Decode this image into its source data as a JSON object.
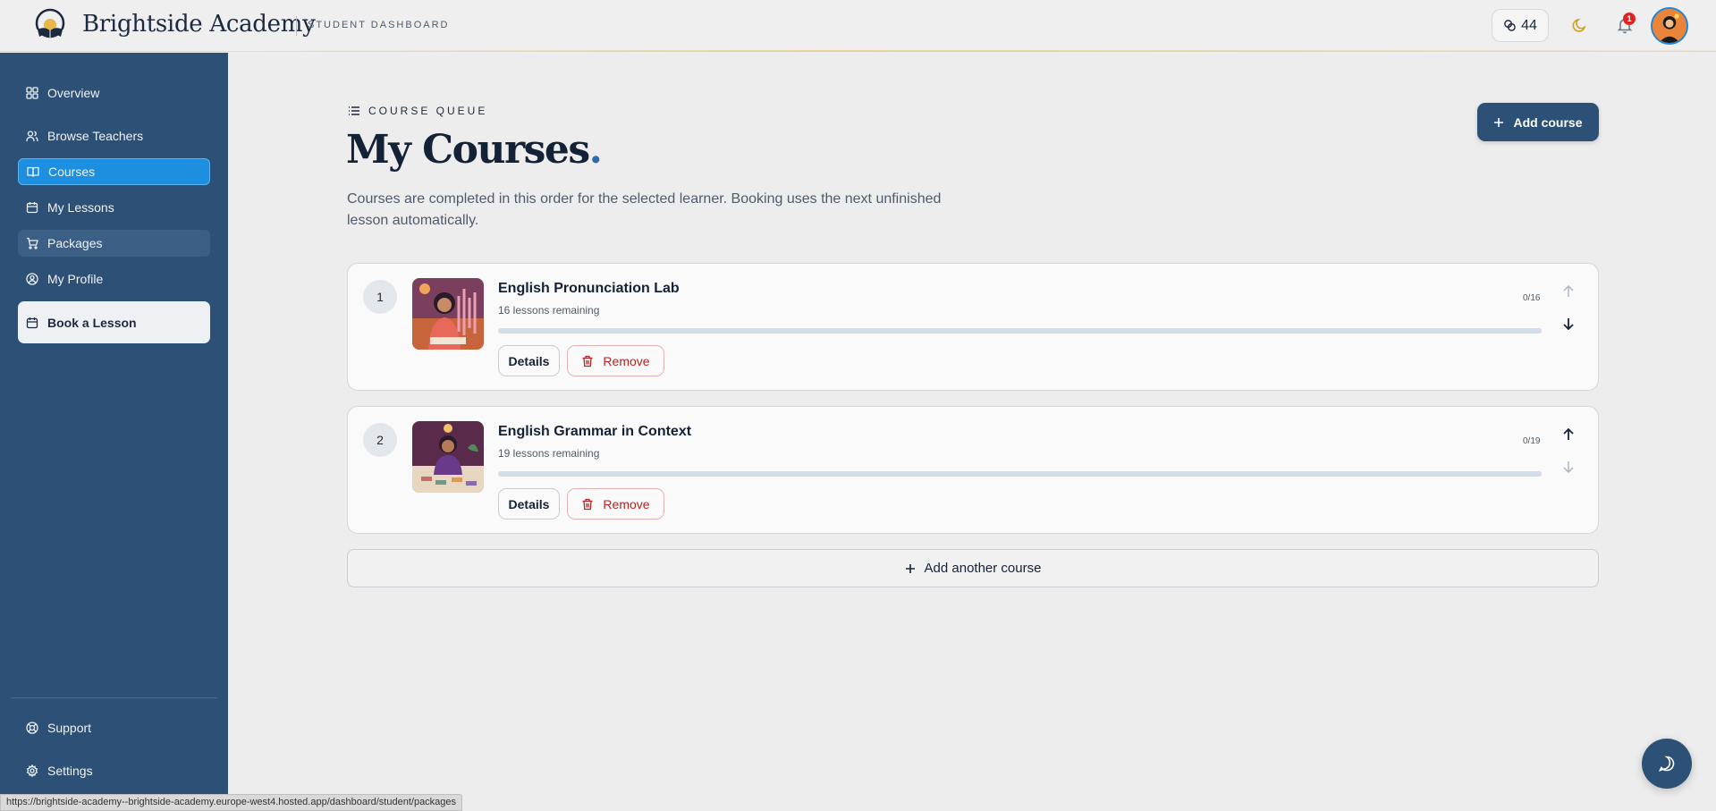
{
  "header": {
    "brand": "Brightside Academy",
    "subtitle": "STUDENT DASHBOARD",
    "credits": "44",
    "notifications": "1"
  },
  "sidebar": {
    "items": [
      {
        "label": "Overview",
        "icon": "grid-icon"
      },
      {
        "label": "Browse Teachers",
        "icon": "users-icon"
      },
      {
        "label": "Courses",
        "icon": "book-open-icon"
      },
      {
        "label": "My Lessons",
        "icon": "calendar-icon"
      },
      {
        "label": "Packages",
        "icon": "cart-icon"
      },
      {
        "label": "My Profile",
        "icon": "user-circle-icon"
      }
    ],
    "book_lesson": "Book a Lesson",
    "support": "Support",
    "settings": "Settings"
  },
  "main": {
    "eyebrow": "COURSE QUEUE",
    "title": "My Courses",
    "title_dot": ".",
    "description": "Courses are completed in this order for the selected learner. Booking uses the next unfinished lesson automatically.",
    "add_course": "Add course",
    "add_another": "Add another course",
    "details_label": "Details",
    "remove_label": "Remove",
    "courses": [
      {
        "number": "1",
        "title": "English Pronunciation Lab",
        "remaining": "16 lessons remaining",
        "count": "0/16",
        "progress": 0
      },
      {
        "number": "2",
        "title": "English Grammar in Context",
        "remaining": "19 lessons remaining",
        "count": "0/19",
        "progress": 0
      }
    ]
  },
  "status_url": "https://brightside-academy--brightside-academy.europe-west4.hosted.app/dashboard/student/packages",
  "colors": {
    "sidebar": "#2d5076",
    "active_nav": "#1d8fe0",
    "remove": "#b52424",
    "badge": "#e02424"
  }
}
